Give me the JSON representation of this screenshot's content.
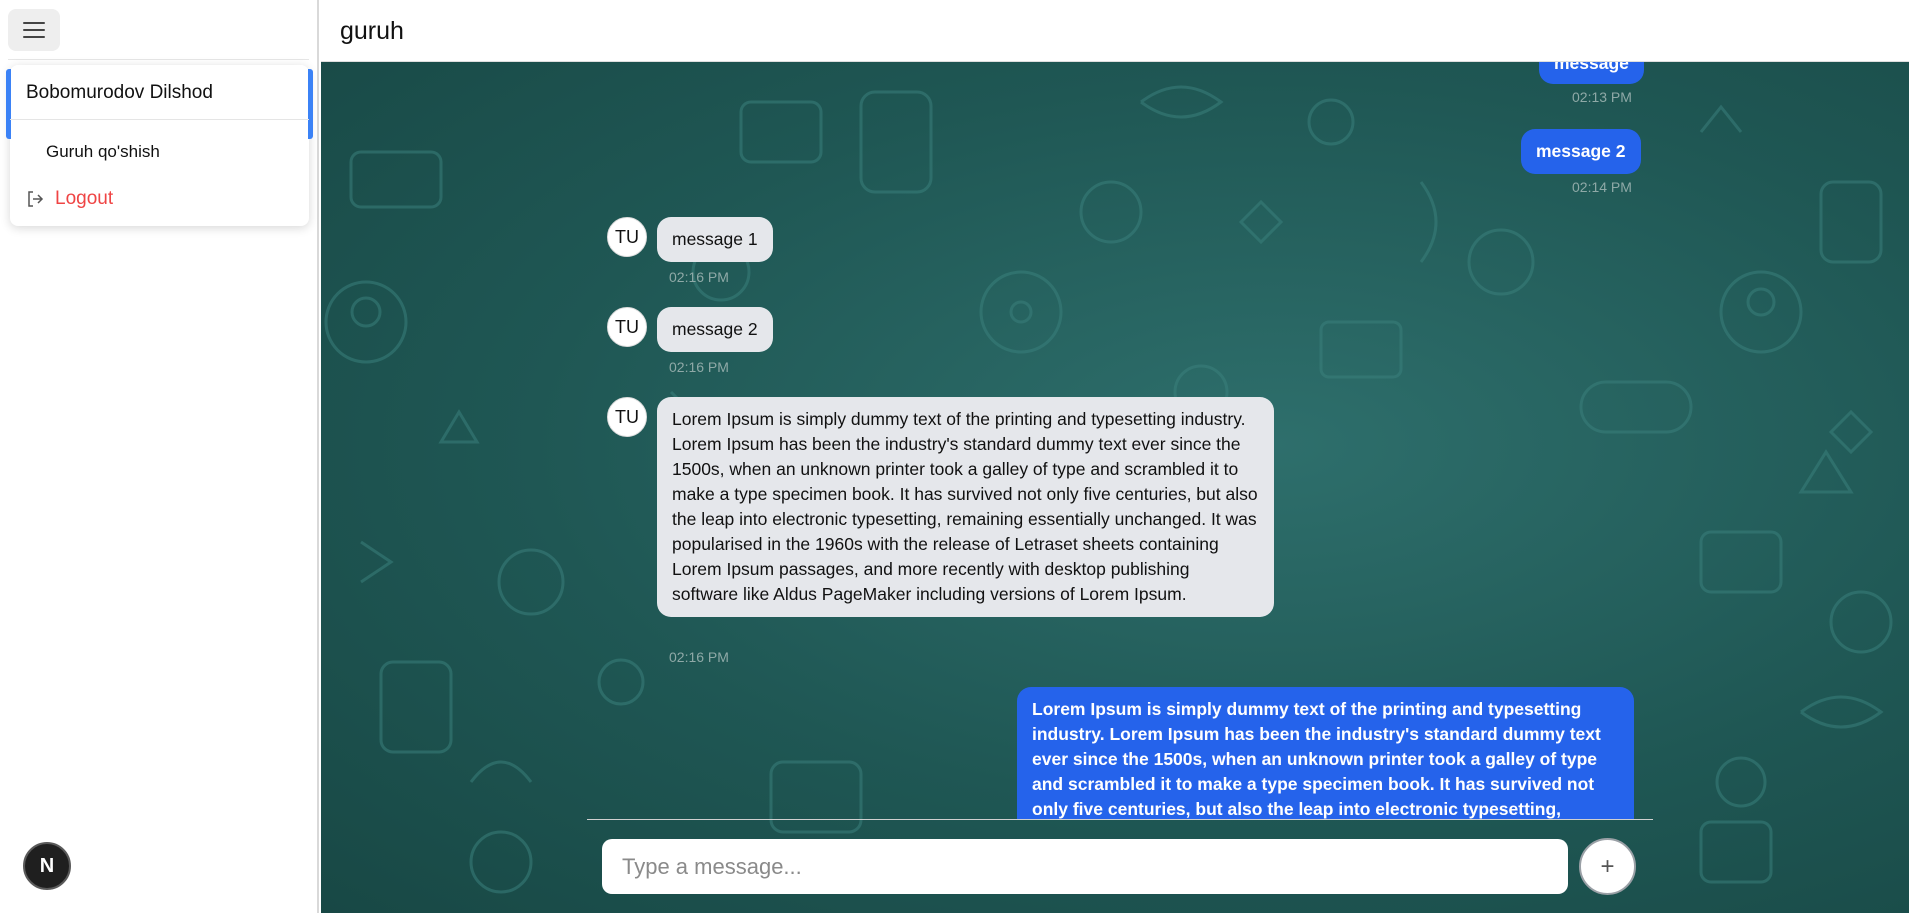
{
  "sidebar": {
    "menu_icon": "hamburger-icon",
    "user_name": "Bobomurodov Dilshod",
    "add_group_label": "Guruh qo'shish",
    "logout_label": "Logout",
    "logout_icon": "logout-icon",
    "badge_letter": "N"
  },
  "header": {
    "title": "guruh"
  },
  "messages": [
    {
      "side": "out",
      "text": "message",
      "time": "02:13 PM"
    },
    {
      "side": "out",
      "text": "message 2",
      "time": "02:14 PM"
    },
    {
      "side": "in",
      "avatar": "TU",
      "text": "message 1",
      "time": "02:16 PM"
    },
    {
      "side": "in",
      "avatar": "TU",
      "text": "message 2",
      "time": "02:16 PM"
    },
    {
      "side": "in",
      "avatar": "TU",
      "text": "Lorem Ipsum is simply dummy text of the printing and typesetting industry. Lorem Ipsum has been the industry's standard dummy text ever since the 1500s, when an unknown printer took a galley of type and scrambled it to make a type specimen book. It has survived not only five centuries, but also the leap into electronic typesetting, remaining essentially unchanged. It was popularised in the 1960s with the release of Letraset sheets containing Lorem Ipsum passages, and more recently with desktop publishing software like Aldus PageMaker including versions of Lorem Ipsum.",
      "time": "02:16 PM"
    },
    {
      "side": "out",
      "text": "Lorem Ipsum is simply dummy text of the printing and typesetting industry. Lorem Ipsum has been the industry's standard dummy text ever since the 1500s, when an unknown printer took a galley of type and scrambled it to make a type specimen book. It has survived not only five centuries, but also the leap into electronic typesetting, remaining"
    }
  ],
  "composer": {
    "placeholder": "Type a message...",
    "value": "",
    "add_icon": "plus-icon"
  },
  "colors": {
    "accent": "#2563eb",
    "chat_bg": "#1f5754",
    "incoming_bubble": "#e5e7eb",
    "logout": "#ef4444"
  }
}
